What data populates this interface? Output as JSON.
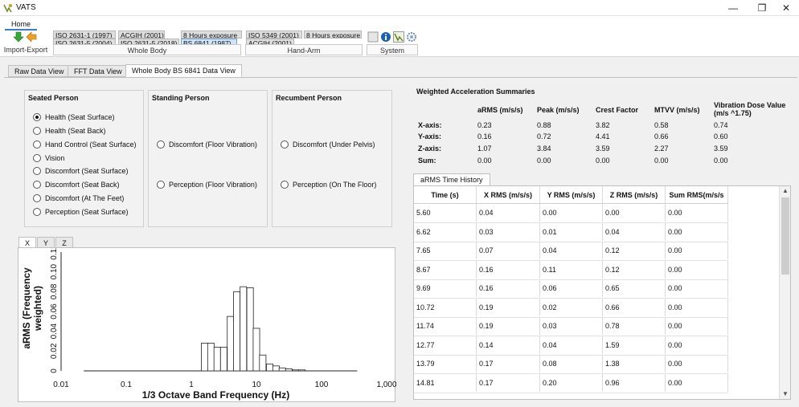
{
  "window": {
    "title": "VATS",
    "minimize": "—",
    "maximize": "❐",
    "close": "✕"
  },
  "ribbon": {
    "home_tab": "Home",
    "groups": {
      "import_export": "Import-Export",
      "whole_body": "Whole Body",
      "hand_arm": "Hand-Arm",
      "system": "System"
    },
    "whole_body_buttons": [
      "ISO 2631-1 (1997)",
      "ACGIH (2001)",
      "8 Hours exposure",
      "ISO 2631-5 (2004)",
      "ISO 2631-5 (2018)",
      "BS 6841 (1987)"
    ],
    "hand_arm_buttons": [
      "ISO 5349 (2001)",
      "8 Hours exposure",
      "ACGIH (2001)"
    ]
  },
  "main_tabs": [
    "Raw Data View",
    "FFT Data View",
    "Whole Body BS 6841 Data View"
  ],
  "seated": {
    "title": "Seated Person",
    "options": [
      "Health (Seat Surface)",
      "Health (Seat Back)",
      "Hand Control (Seat Surface)",
      "Vision",
      "Discomfort (Seat Surface)",
      "Discomfort (Seat Back)",
      "Discomfort (At The Feet)",
      "Perception (Seat Surface)"
    ],
    "selected": 0
  },
  "standing": {
    "title": "Standing Person",
    "options": [
      "Discomfort (Floor Vibration)",
      "Perception (Floor Vibration)"
    ]
  },
  "recumbent": {
    "title": "Recumbent Person",
    "options": [
      "Discomfort (Under Pelvis)",
      "Perception (On The Floor)"
    ]
  },
  "summary": {
    "title": "Weighted Acceleration Summaries",
    "headers": [
      "aRMS (m/s/s)",
      "Peak (m/s/s)",
      "Crest Factor",
      "MTVV (m/s/s)",
      "Vibration Dose Value",
      "(m/s ^1.75)"
    ],
    "rows": [
      {
        "label": "X-axis:",
        "values": [
          "0.23",
          "0.88",
          "3.82",
          "0.58",
          "0.74"
        ]
      },
      {
        "label": "Y-axis:",
        "values": [
          "0.16",
          "0.72",
          "4.41",
          "0.66",
          "0.60"
        ]
      },
      {
        "label": "Z-axis:",
        "values": [
          "1.07",
          "3.84",
          "3.59",
          "2.27",
          "3.59"
        ]
      },
      {
        "label": "Sum:",
        "values": [
          "0.00",
          "0.00",
          "0.00",
          "0.00",
          "0.00"
        ]
      }
    ]
  },
  "history": {
    "tab": "aRMS Time History",
    "headers": [
      "Time (s)",
      "X RMS (m/s/s)",
      "Y RMS (m/s/s)",
      "Z RMS (m/s/s)",
      "Sum RMS(m/s/s"
    ],
    "rows": [
      [
        "5.60",
        "0.04",
        "0.00",
        "0.00",
        "0.00"
      ],
      [
        "6.62",
        "0.03",
        "0.01",
        "0.04",
        "0.00"
      ],
      [
        "7.65",
        "0.07",
        "0.04",
        "0.12",
        "0.00"
      ],
      [
        "8.67",
        "0.16",
        "0.11",
        "0.12",
        "0.00"
      ],
      [
        "9.69",
        "0.16",
        "0.06",
        "0.65",
        "0.00"
      ],
      [
        "10.72",
        "0.19",
        "0.02",
        "0.66",
        "0.00"
      ],
      [
        "11.74",
        "0.19",
        "0.03",
        "0.78",
        "0.00"
      ],
      [
        "12.77",
        "0.14",
        "0.04",
        "1.59",
        "0.00"
      ],
      [
        "13.79",
        "0.17",
        "0.08",
        "1.38",
        "0.00"
      ],
      [
        "14.81",
        "0.17",
        "0.20",
        "0.96",
        "0.00"
      ]
    ]
  },
  "chart_tabs": [
    "X",
    "Y",
    "Z"
  ],
  "chart_data": {
    "type": "bar",
    "xlabel": "1/3 Octave Band Frequency (Hz)",
    "ylabel": "aRMS (Frequency weighted)",
    "xscale": "log",
    "xlim": [
      0.01,
      1000
    ],
    "ylim": [
      0,
      0.12
    ],
    "x_ticks": [
      "0.01",
      "0.1",
      "1",
      "10",
      "100",
      "1,000"
    ],
    "y_ticks": [
      "0",
      "0.02",
      "0.04",
      "0.06",
      "0.08",
      "0.10",
      "0.12"
    ],
    "bands_hz": [
      0.025,
      0.0315,
      0.04,
      0.05,
      0.063,
      0.08,
      0.1,
      0.125,
      0.16,
      0.2,
      0.25,
      0.315,
      0.4,
      0.5,
      0.63,
      0.8,
      1,
      1.25,
      1.6,
      2,
      2.5,
      3.15,
      4,
      5,
      6.3,
      8,
      10,
      12.5,
      16,
      20,
      25,
      31.5,
      40,
      50,
      63,
      80,
      100,
      125,
      160,
      200,
      250,
      315
    ],
    "values": [
      0,
      0,
      0,
      0,
      0,
      0,
      0,
      0,
      0,
      0,
      0,
      0,
      0,
      0,
      0,
      0,
      0,
      0,
      0.028,
      0.028,
      0.024,
      0.024,
      0.055,
      0.08,
      0.085,
      0.084,
      0.043,
      0.016,
      0.007,
      0.005,
      0.003,
      0.002,
      0.001,
      0.001,
      0,
      0,
      0,
      0,
      0,
      0,
      0,
      0
    ]
  }
}
